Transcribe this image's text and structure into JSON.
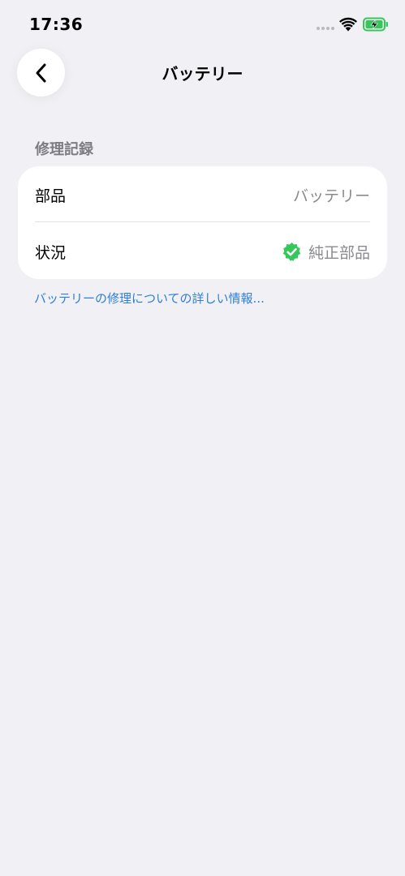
{
  "status_bar": {
    "time": "17:36"
  },
  "nav": {
    "title": "バッテリー",
    "back_icon": "chevron-left-icon"
  },
  "section": {
    "header": "修理記録"
  },
  "rows": [
    {
      "label": "部品",
      "value": "バッテリー"
    },
    {
      "label": "状況",
      "value": "純正部品",
      "icon": "verified-badge-icon",
      "icon_color": "#34c759"
    }
  ],
  "link": {
    "text": "バッテリーの修理についての詳しい情報..."
  },
  "colors": {
    "background": "#f0f0f5",
    "accent_link": "#2f7fd6",
    "badge_green": "#34c759",
    "battery_green": "#34c759"
  }
}
